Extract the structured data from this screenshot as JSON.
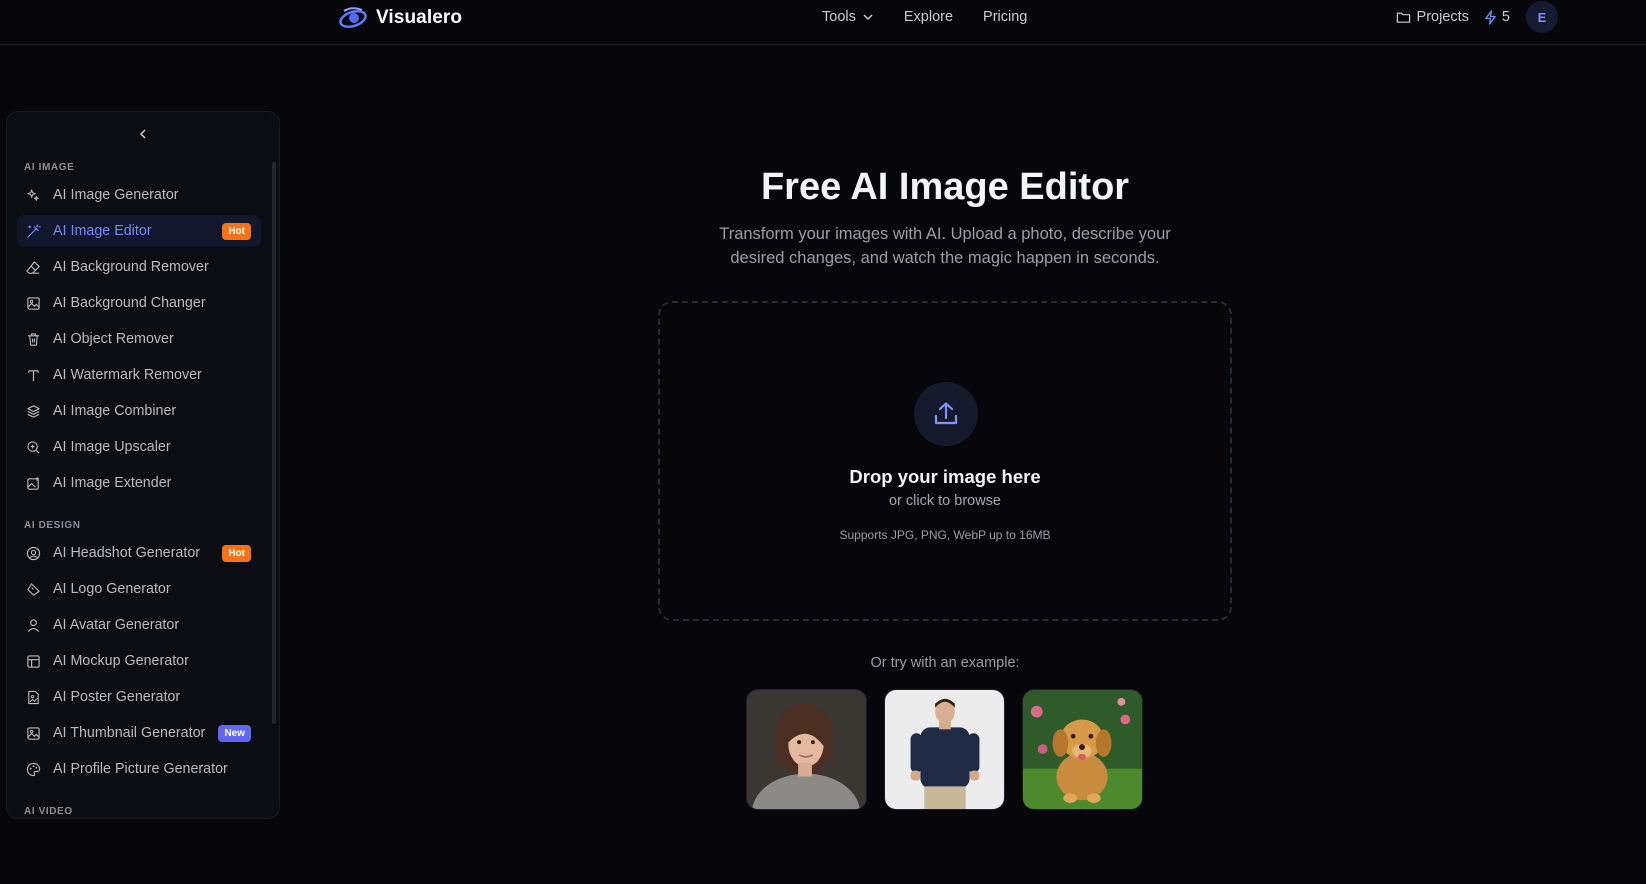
{
  "header": {
    "brand": "Visualero",
    "nav": [
      {
        "label": "Tools",
        "has_dropdown": true
      },
      {
        "label": "Explore"
      },
      {
        "label": "Pricing"
      }
    ],
    "projects_label": "Projects",
    "credits": "5",
    "avatar_initial": "E"
  },
  "sidebar": {
    "sections": [
      {
        "title": "AI IMAGE",
        "items": [
          {
            "label": "AI Image Generator",
            "icon": "sparkles-icon"
          },
          {
            "label": "AI Image Editor",
            "icon": "magic-wand-icon",
            "active": true,
            "badge": "Hot"
          },
          {
            "label": "AI Background Remover",
            "icon": "eraser-icon"
          },
          {
            "label": "AI Background Changer",
            "icon": "image-icon"
          },
          {
            "label": "AI Object Remover",
            "icon": "trash-icon"
          },
          {
            "label": "AI Watermark Remover",
            "icon": "type-icon"
          },
          {
            "label": "AI Image Combiner",
            "icon": "layers-icon"
          },
          {
            "label": "AI Image Upscaler",
            "icon": "zoom-in-icon"
          },
          {
            "label": "AI Image Extender",
            "icon": "image-plus-icon"
          }
        ]
      },
      {
        "title": "AI DESIGN",
        "items": [
          {
            "label": "AI Headshot Generator",
            "icon": "user-circle-icon",
            "badge": "Hot"
          },
          {
            "label": "AI Logo Generator",
            "icon": "pen-tool-icon"
          },
          {
            "label": "AI Avatar Generator",
            "icon": "user-icon"
          },
          {
            "label": "AI Mockup Generator",
            "icon": "layout-icon"
          },
          {
            "label": "AI Poster Generator",
            "icon": "file-image-icon"
          },
          {
            "label": "AI Thumbnail Generator",
            "icon": "image-icon",
            "badge": "New"
          },
          {
            "label": "AI Profile Picture Generator",
            "icon": "palette-icon"
          }
        ]
      },
      {
        "title": "AI VIDEO",
        "items": []
      }
    ]
  },
  "main": {
    "title": "Free AI Image Editor",
    "subtitle": "Transform your images with AI. Upload a photo, describe your desired changes, and watch the magic happen in seconds.",
    "dropzone": {
      "title": "Drop your image here",
      "subtitle": "or click to browse",
      "note": "Supports JPG, PNG, WebP up to 16MB"
    },
    "examples_label": "Or try with an example:"
  },
  "colors": {
    "background": "#07070b",
    "accent": "#6f8bff",
    "hot_badge": "#f97316",
    "new_badge": "#6366f1"
  }
}
